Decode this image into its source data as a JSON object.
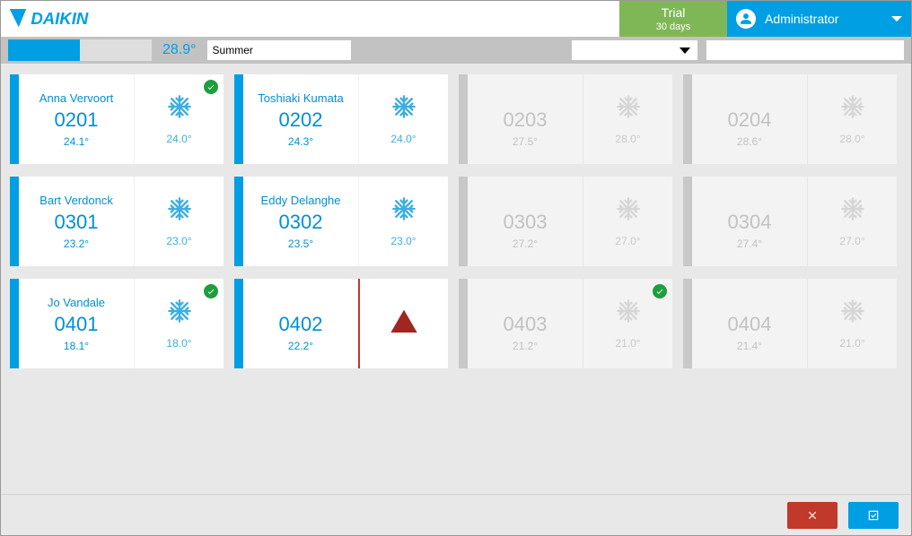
{
  "header": {
    "logo_text": "DAIKIN",
    "trial_line1": "Trial",
    "trial_line2": "30 days",
    "user_name": "Administrator"
  },
  "toolbar": {
    "outdoor_temp": "28.9°",
    "season": "Summer"
  },
  "rooms": [
    {
      "guest": "Anna Vervoort",
      "number": "0201",
      "temp": "24.1°",
      "setpoint": "24.0°",
      "mode": "cool",
      "active": true,
      "check": true,
      "alert": false
    },
    {
      "guest": "Toshiaki Kumata",
      "number": "0202",
      "temp": "24.3°",
      "setpoint": "24.0°",
      "mode": "cool",
      "active": true,
      "check": false,
      "alert": false
    },
    {
      "guest": "",
      "number": "0203",
      "temp": "27.5°",
      "setpoint": "28.0°",
      "mode": "cool",
      "active": false,
      "check": false,
      "alert": false
    },
    {
      "guest": "",
      "number": "0204",
      "temp": "28.6°",
      "setpoint": "28.0°",
      "mode": "cool",
      "active": false,
      "check": false,
      "alert": false
    },
    {
      "guest": "Bart Verdonck",
      "number": "0301",
      "temp": "23.2°",
      "setpoint": "23.0°",
      "mode": "cool",
      "active": true,
      "check": false,
      "alert": false
    },
    {
      "guest": "Eddy Delanghe",
      "number": "0302",
      "temp": "23.5°",
      "setpoint": "23.0°",
      "mode": "cool",
      "active": true,
      "check": false,
      "alert": false
    },
    {
      "guest": "",
      "number": "0303",
      "temp": "27.2°",
      "setpoint": "27.0°",
      "mode": "cool",
      "active": false,
      "check": false,
      "alert": false
    },
    {
      "guest": "",
      "number": "0304",
      "temp": "27.4°",
      "setpoint": "27.0°",
      "mode": "cool",
      "active": false,
      "check": false,
      "alert": false
    },
    {
      "guest": "Jo Vandale",
      "number": "0401",
      "temp": "18.1°",
      "setpoint": "18.0°",
      "mode": "cool",
      "active": true,
      "check": true,
      "alert": false
    },
    {
      "guest": "",
      "number": "0402",
      "temp": "22.2°",
      "setpoint": "",
      "mode": "alert",
      "active": true,
      "check": false,
      "alert": true
    },
    {
      "guest": "",
      "number": "0403",
      "temp": "21.2°",
      "setpoint": "21.0°",
      "mode": "cool",
      "active": false,
      "check": true,
      "alert": false
    },
    {
      "guest": "",
      "number": "0404",
      "temp": "21.4°",
      "setpoint": "21.0°",
      "mode": "cool",
      "active": false,
      "check": false,
      "alert": false
    }
  ],
  "icons": {
    "snowflake": "snowflake-icon",
    "alert": "alert-icon",
    "check": "check-icon",
    "close": "close-icon",
    "confirm": "confirm-icon"
  }
}
